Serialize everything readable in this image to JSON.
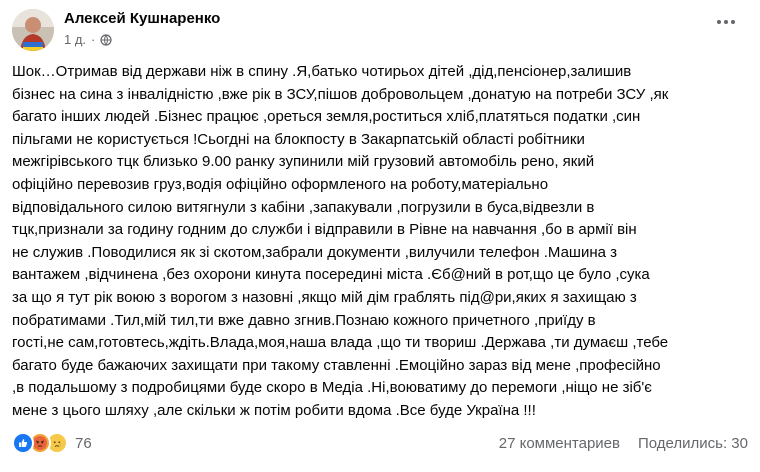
{
  "post": {
    "author": "Алексей Кушнаренко",
    "time": "1 д.",
    "privacy_icon": "globe-icon",
    "more_icon": "more-options-icon",
    "lines": [
      "Шок…Отримав від держави ніж в спину .Я,батько чотирьох дітей ,дід,пенсіонер,залишив",
      "бізнес на сина з інвалідністю ,вже рік в ЗСУ,пішов добровольцем ,донатую на потреби ЗСУ ,як",
      "багато інших  людей .Бізнес працює ,ореться земля,роститься хліб,платяться податки ,син",
      "пільгами не користується !Сьогдні на блокпосту в Закарпатській області робітники",
      "межгірівського тцк близько  9.00 ранку  зупинили  мій грузовий автомобіль рено, який",
      "офіційно перевозив груз,водія офіційно  оформленого на роботу,матеріально",
      "відповідального силою витягнули з кабіни ,запакували ,погрузили  в буса,відвезли в",
      "тцк,признали за годину  годним до служби і відправили  в Рівне на навчання ,бо в армії він",
      "не служив .Поводилися як зі скотом,забрали документи ,вилучили телефон .Машина з",
      "вантажем ,відчинена ,без охорони кинута посередині міста .Єб@ний в рот,що це було ,сука",
      "за що я тут рік воюю з ворогом з назовні ,якщо мій дім граблять під@ри,яких я захищаю з",
      "побратимами .Тил,мій тил,ти вже давно  згнив.Познаю кожного причетного ,приїду  в",
      "гості,не сам,готовтесь,ждіть.Влада,моя,наша влада ,що ти твориш .Держава ,ти думаєш ,тебе",
      "багато буде бажаючих захищати при такому ставленні .Емоційно зараз від мене ,професійно",
      ",в подальшому з подробицями буде скоро в Медіа .Ні,воюватиму до перемоги ,ніщо не зіб'є",
      "мене з цього шляху ,але скільки  ж потім робити вдома .Все буде Україна !!!"
    ]
  },
  "reactions": {
    "icons": [
      "like-icon",
      "angry-icon",
      "sad-icon"
    ],
    "count": "76"
  },
  "stats": {
    "comments": "27 комментариев",
    "shares": "Поделились: 30"
  },
  "colors": {
    "like": "#1877f2",
    "angry": "#f0a43a",
    "sad": "#f7c948",
    "secondary_text": "#65676b"
  }
}
